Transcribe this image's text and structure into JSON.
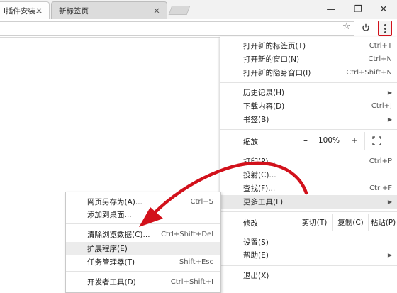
{
  "tabs": [
    {
      "label": "l插件安装...",
      "close": "×"
    },
    {
      "label": "新标签页",
      "close": "×"
    }
  ],
  "window_controls": {
    "minimize": "—",
    "maximize": "❐",
    "close": "✕"
  },
  "toolbar": {
    "star_icon": "☆",
    "power_icon": "power-icon",
    "menu_icon": "vertical-dots-icon"
  },
  "menu": {
    "new_tab": {
      "label": "打开新的标签页(T)",
      "shortcut": "Ctrl+T"
    },
    "new_window": {
      "label": "打开新的窗口(N)",
      "shortcut": "Ctrl+N"
    },
    "new_incognito": {
      "label": "打开新的隐身窗口(I)",
      "shortcut": "Ctrl+Shift+N"
    },
    "history": {
      "label": "历史记录(H)",
      "arrow": "▶"
    },
    "downloads": {
      "label": "下载内容(D)",
      "shortcut": "Ctrl+J"
    },
    "bookmarks": {
      "label": "书签(B)",
      "arrow": "▶"
    },
    "zoom": {
      "label": "缩放",
      "minus": "–",
      "value": "100%",
      "plus": "+"
    },
    "print": {
      "label": "打印(P)...",
      "shortcut": "Ctrl+P"
    },
    "cast": {
      "label": "投射(C)..."
    },
    "find": {
      "label": "查找(F)...",
      "shortcut": "Ctrl+F"
    },
    "more_tools": {
      "label": "更多工具(L)",
      "arrow": "▶"
    },
    "edit": {
      "label": "修改",
      "cut": "剪切(T)",
      "copy": "复制(C)",
      "paste": "粘贴(P)"
    },
    "settings": {
      "label": "设置(S)"
    },
    "help": {
      "label": "帮助(E)",
      "arrow": "▶"
    },
    "exit": {
      "label": "退出(X)"
    }
  },
  "submenu": {
    "save_page": {
      "label": "网页另存为(A)...",
      "shortcut": "Ctrl+S"
    },
    "add_desktop": {
      "label": "添加到桌面..."
    },
    "clear_data": {
      "label": "清除浏览数据(C)...",
      "shortcut": "Ctrl+Shift+Del"
    },
    "extensions": {
      "label": "扩展程序(E)"
    },
    "task_manager": {
      "label": "任务管理器(T)",
      "shortcut": "Shift+Esc"
    },
    "dev_tools": {
      "label": "开发者工具(D)",
      "shortcut": "Ctrl+Shift+I"
    }
  },
  "colors": {
    "highlight": "#d2111b",
    "menu_hover": "#e8e8e8"
  }
}
